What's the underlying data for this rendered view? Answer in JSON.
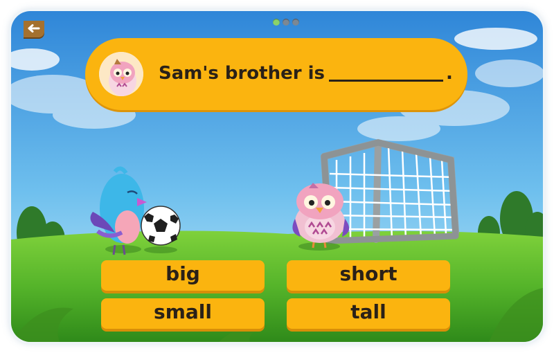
{
  "question": {
    "text": "Sam's brother is",
    "end_punctuation": ".",
    "avatar": "owl-avatar-icon"
  },
  "answers": [
    {
      "label": "big"
    },
    {
      "label": "short"
    },
    {
      "label": "small"
    },
    {
      "label": "tall"
    }
  ],
  "pagination": {
    "total": 3,
    "current": 1
  },
  "colors": {
    "accent": "#fbb40f",
    "sky": "#4aa3e6",
    "grass": "#5fbf2e",
    "text": "#2a2118"
  }
}
